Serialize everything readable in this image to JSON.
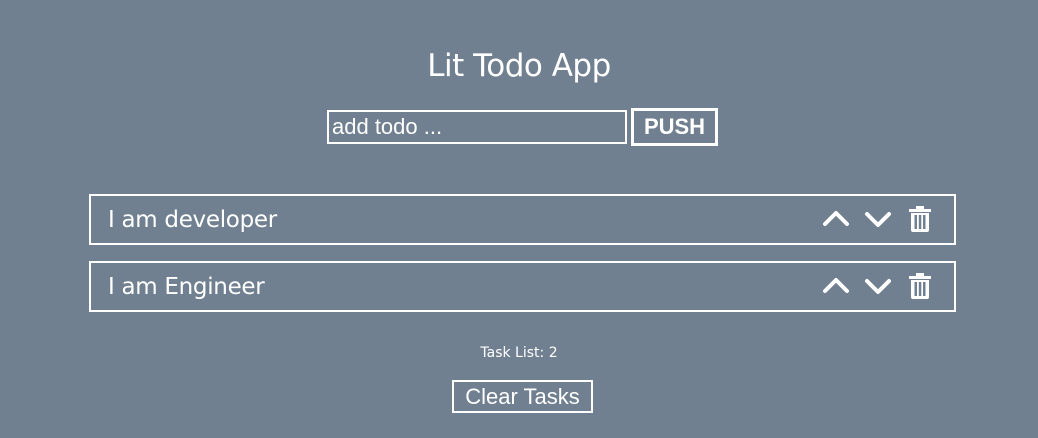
{
  "app": {
    "title": "Lit Todo App"
  },
  "input": {
    "placeholder": "add todo ...",
    "value": ""
  },
  "push_button": {
    "label": "PUSH"
  },
  "tasks": [
    {
      "text": "I am developer",
      "icons": [
        "chevron-up-icon",
        "chevron-down-icon",
        "trash-icon"
      ]
    },
    {
      "text": "I am Engineer",
      "icons": [
        "chevron-up-icon",
        "chevron-down-icon",
        "trash-icon"
      ]
    }
  ],
  "footer": {
    "task_count": "Task List: 2",
    "clear_label": "Clear Tasks"
  },
  "colors": {
    "background": "#708090",
    "foreground": "#ffffff"
  }
}
